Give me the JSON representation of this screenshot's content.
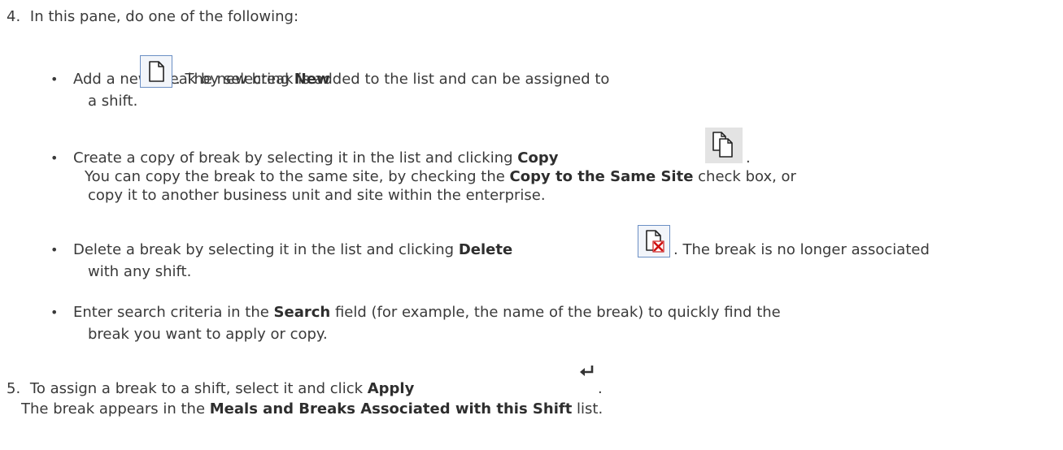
{
  "step4": {
    "number": "4.",
    "intro": "In this pane, do one of the following:"
  },
  "bullets": {
    "new": {
      "pre": "Add a new break by selecting ",
      "bold": "New",
      "post": ". The new break is added to the list and can be assigned to",
      "cont": "a shift."
    },
    "copy": {
      "pre": "Create a copy of break by selecting it in the list and clicking ",
      "bold": "Copy",
      "post": ".",
      "line2_pre": "You can copy the break to the same site, by checking the ",
      "line2_bold": "Copy to the Same Site",
      "line2_post": " check box, or",
      "line3": "copy it to another business unit and site within the enterprise."
    },
    "delete": {
      "pre": "Delete a break by selecting it in the list and clicking ",
      "bold": "Delete",
      "post": ". The break is no longer associated",
      "cont": "with any shift."
    },
    "search": {
      "pre": "Enter search criteria in the ",
      "bold": "Search",
      "post": " field (for example, the name of the break) to quickly find the",
      "cont": "break you want to apply or copy."
    }
  },
  "step5": {
    "number": "5.",
    "pre": "To assign a break to a shift, select it and click ",
    "bold": "Apply",
    "post": ".",
    "line2_pre": "The break appears in the ",
    "line2_bold": "Meals and Breaks Associated with this Shift",
    "line2_post": " list."
  },
  "icons": {
    "new": "new-document-icon",
    "copy": "copy-icon",
    "delete": "delete-document-icon",
    "apply": "apply-return-arrow-icon"
  }
}
